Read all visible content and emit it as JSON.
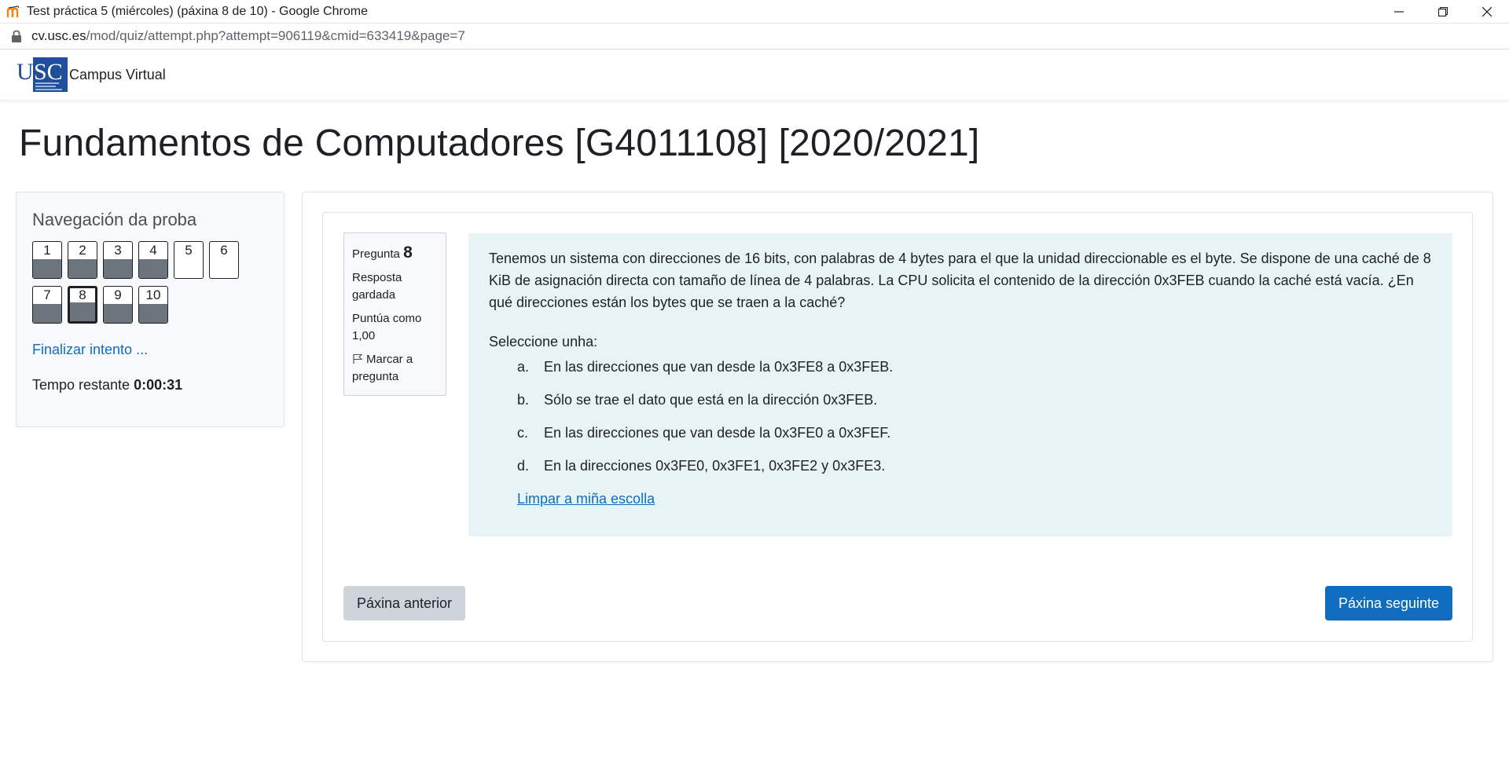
{
  "browser": {
    "window_title": "Test práctica 5 (miércoles) (páxina 8 de 10) - Google Chrome",
    "url_host": "cv.usc.es",
    "url_path": "/mod/quiz/attempt.php?attempt=906119&cmid=633419&page=7"
  },
  "site": {
    "logo_text": "USC",
    "brand": "Campus Virtual"
  },
  "course": {
    "title": "Fundamentos de Computadores [G4011108] [2020/2021]"
  },
  "quiz_nav": {
    "heading": "Navegación da proba",
    "questions": [
      {
        "label": "1",
        "answered": true,
        "current": false
      },
      {
        "label": "2",
        "answered": true,
        "current": false
      },
      {
        "label": "3",
        "answered": true,
        "current": false
      },
      {
        "label": "4",
        "answered": true,
        "current": false
      },
      {
        "label": "5",
        "answered": false,
        "current": false
      },
      {
        "label": "6",
        "answered": false,
        "current": false
      },
      {
        "label": "7",
        "answered": true,
        "current": false
      },
      {
        "label": "8",
        "answered": true,
        "current": true
      },
      {
        "label": "9",
        "answered": true,
        "current": false
      },
      {
        "label": "10",
        "answered": true,
        "current": false
      }
    ],
    "finish_label": "Finalizar intento ...",
    "time_label": "Tempo restante",
    "time_value": "0:00:31"
  },
  "question_info": {
    "label": "Pregunta",
    "number": "8",
    "state": "Resposta gardada",
    "score": "Puntúa como 1,00",
    "flag_label": "Marcar a pregunta"
  },
  "question": {
    "text": "Tenemos un sistema con direcciones de 16 bits, con palabras de 4 bytes para el que la unidad direccionable es el byte. Se dispone de una caché de 8 KiB de asignación directa con tamaño de línea de 4 palabras. La CPU solicita el contenido de la dirección 0x3FEB cuando la caché está vacía. ¿En qué direcciones están los bytes que se traen a la caché?",
    "prompt": "Seleccione unha:",
    "answers": [
      {
        "letter": "a.",
        "text": "En las direcciones que van desde la 0x3FE8 a 0x3FEB."
      },
      {
        "letter": "b.",
        "text": "Sólo se trae el dato que está en la dirección 0x3FEB."
      },
      {
        "letter": "c.",
        "text": "En las direcciones que van desde la 0x3FE0 a 0x3FEF."
      },
      {
        "letter": "d.",
        "text": "En la direcciones 0x3FE0, 0x3FE1, 0x3FE2 y 0x3FE3."
      }
    ],
    "clear_label": "Limpar a miña escolla"
  },
  "buttons": {
    "prev": "Páxina anterior",
    "next": "Páxina seguinte"
  },
  "colors": {
    "link": "#0f6cbf",
    "primary_button": "#0f6cbf",
    "secondary_button": "#ced4da",
    "formulation_bg": "#e7f3f5",
    "answered_fill": "#6c757d"
  }
}
